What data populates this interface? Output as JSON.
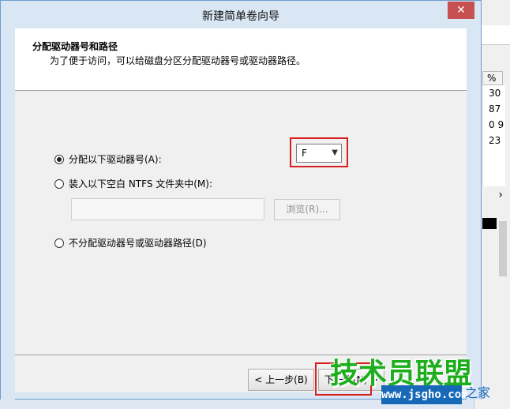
{
  "background": {
    "header": "%",
    "values": [
      "30",
      "87",
      "0 9",
      "23"
    ],
    "scroll_right": "›"
  },
  "dialog": {
    "title": "新建简单卷向导",
    "close": "✕",
    "heading": "分配驱动器号和路径",
    "subheading": "为了便于访问，可以给磁盘分区分配驱动器号或驱动器路径。",
    "option_assign": "分配以下驱动器号(A):",
    "option_mount": "装入以下空白 NTFS 文件夹中(M):",
    "option_none": "不分配驱动器号或驱动器路径(D)",
    "drive_letter": "F",
    "browse": "浏览(R)...",
    "back": "< 上一步(B)",
    "next": "下一步(N) >"
  },
  "watermark": {
    "logo": "技术员联盟",
    "url": "www.jsgho.com",
    "suffix": "之家"
  },
  "colors": {
    "highlight": "#d71f1f",
    "accent": "#1769b8",
    "watermark_green": "#1dae1d"
  }
}
